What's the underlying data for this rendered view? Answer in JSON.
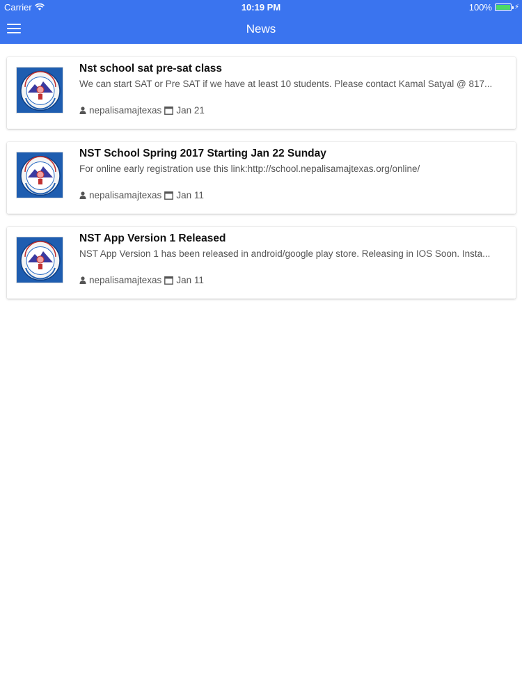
{
  "status_bar": {
    "carrier": "Carrier",
    "time": "10:19 PM",
    "battery": "100%"
  },
  "header": {
    "title": "News",
    "menu_icon": "hamburger-menu-icon",
    "color": "#3a74ef"
  },
  "news": [
    {
      "title": "Nst school sat pre-sat class",
      "description": "We can start SAT or Pre SAT if we have at least 10 students. Please contact Kamal Satyal @ 817...",
      "author": "nepalisamajtexas",
      "date": "Jan 21"
    },
    {
      "title": "NST School Spring 2017 Starting Jan 22 Sunday",
      "description": "For online early registration use this link:http://school.nepalisamajtexas.org/online/",
      "author": "nepalisamajtexas",
      "date": "Jan 11"
    },
    {
      "title": "NST App Version 1 Released",
      "description": "NST App Version 1 has been released in android/google play store. Releasing in IOS Soon. Insta...",
      "author": "nepalisamajtexas",
      "date": "Jan 11"
    }
  ]
}
